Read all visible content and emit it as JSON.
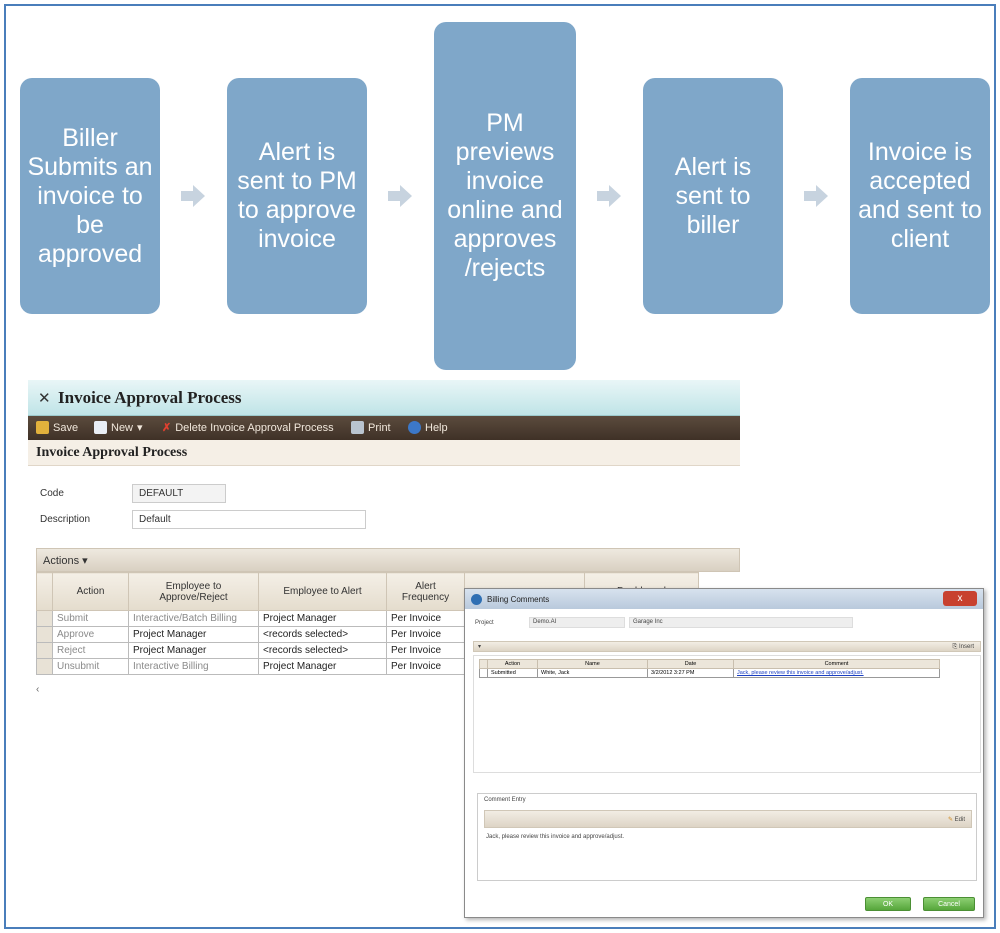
{
  "flow": {
    "steps": [
      "Biller Submits an invoice to be approved",
      "Alert is sent to PM to approve invoice",
      "PM previews invoice online and approves /rejects",
      "Alert is sent to biller",
      "Invoice is accepted and sent to client"
    ],
    "box_color": "#7fa7c9",
    "arrow_color": "#c7d3df"
  },
  "invoice_window": {
    "title": "Invoice Approval Process",
    "toolbar": {
      "save": "Save",
      "new": "New",
      "delete": "Delete Invoice Approval Process",
      "print": "Print",
      "help": "Help"
    },
    "subtitle": "Invoice Approval Process",
    "code_label": "Code",
    "code_value": "DEFAULT",
    "description_label": "Description",
    "description_value": "Default",
    "actions_label": "Actions",
    "columns": [
      "Action",
      "Employee to Approve/Reject",
      "Employee to Alert",
      "Alert Frequency",
      "",
      "Dashboard"
    ],
    "rows": [
      [
        "Submit",
        "Interactive/Batch Billing",
        "Project Manager",
        "Per Invoice"
      ],
      [
        "Approve",
        "Project Manager",
        "<records selected>",
        "Per Invoice"
      ],
      [
        "Reject",
        "Project Manager",
        "<records selected>",
        "Per Invoice"
      ],
      [
        "Unsubmit",
        "Interactive Billing",
        "Project Manager",
        "Per Invoice"
      ]
    ]
  },
  "dialog": {
    "title": "Billing Comments",
    "close": "x",
    "project_label": "Project",
    "project_value": "Demo.AI",
    "client_value": "Garage Inc",
    "insert": "Insert",
    "columns": [
      "Action",
      "Name",
      "Date",
      "Comment"
    ],
    "row": [
      "Submitted",
      "White, Jack",
      "3/2/2012 3:27 PM",
      "Jack, please review this invoice and approve/adjust."
    ],
    "comment_entry_label": "Comment Entry",
    "edit": "Edit",
    "comment_text": "Jack, please review this invoice and approve/adjust.",
    "ok": "OK",
    "cancel": "Cancel"
  }
}
